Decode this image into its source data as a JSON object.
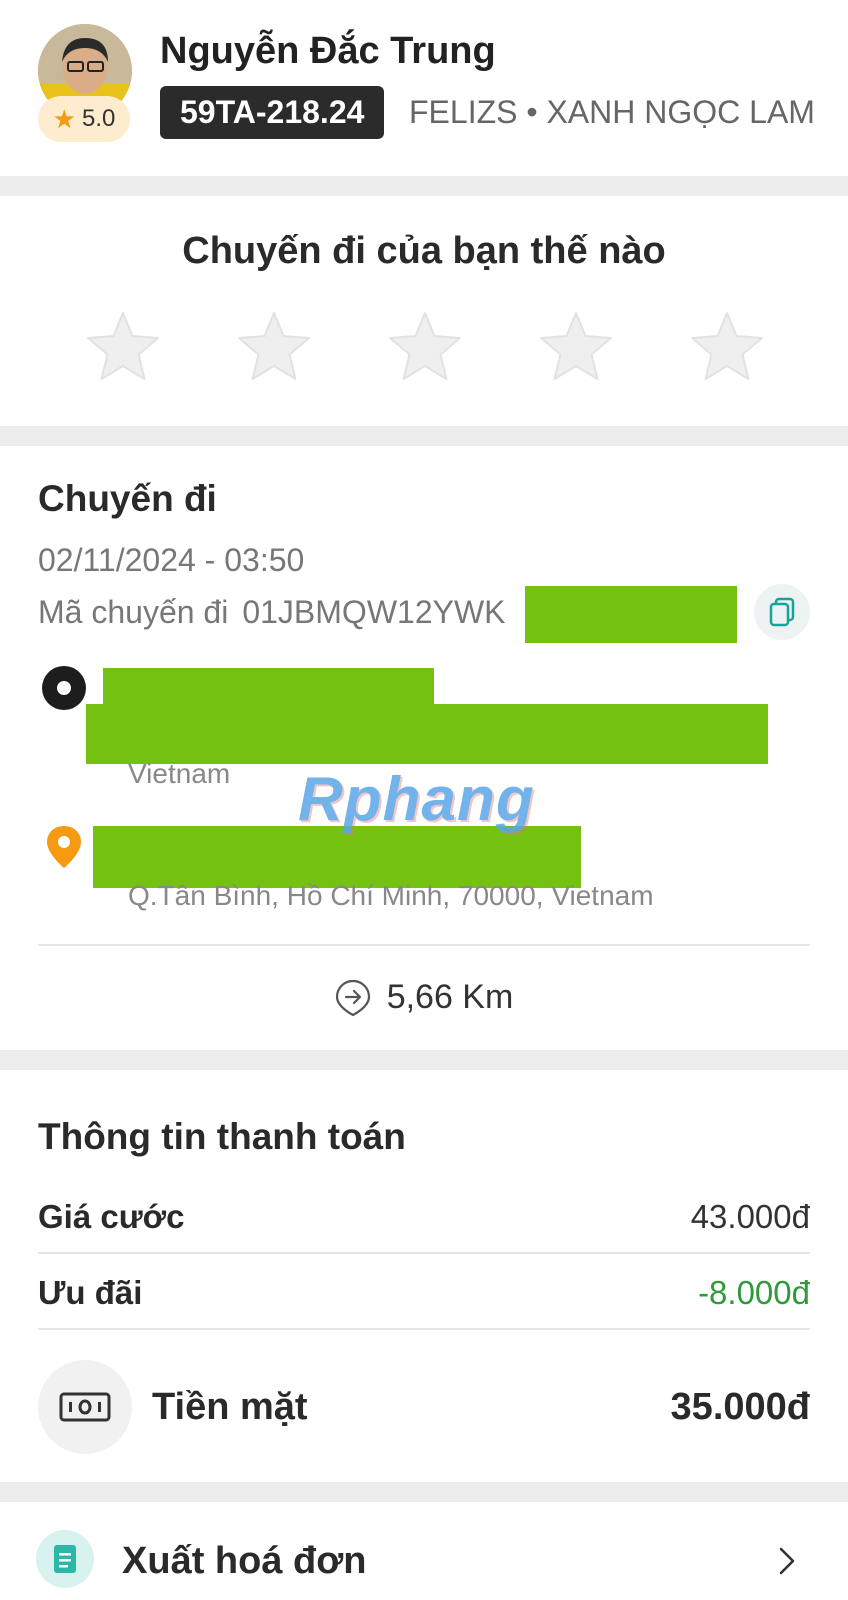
{
  "driver": {
    "name": "Nguyễn Đắc Trung",
    "rating": "5.0",
    "plate": "59TA-218.24",
    "vehicle": "FELIZS • XANH NGỌC LAM"
  },
  "rating_prompt": {
    "title": "Chuyến đi của bạn thế nào",
    "star_count": 5,
    "selected": 0
  },
  "trip": {
    "title": "Chuyến đi",
    "datetime": "02/11/2024 - 03:50",
    "code_label": "Mã chuyến đi",
    "code_value": "01JBMQW12YWK",
    "pickup_sub": "Vietnam",
    "dropoff_sub": "Q.Tân Bình, Hồ Chí Minh, 70000, Vietnam",
    "distance": "5,66 Km",
    "watermark": "Rphang"
  },
  "payment": {
    "title": "Thông tin thanh toán",
    "fare_label": "Giá cước",
    "fare_value": "43.000đ",
    "discount_label": "Ưu đãi",
    "discount_value": "-8.000đ",
    "method_label": "Tiền mặt",
    "total": "35.000đ"
  },
  "invoice": {
    "label": "Xuất hoá đơn"
  },
  "colors": {
    "accent_orange": "#f59a11",
    "discount_green": "#2f9a3a",
    "redaction_green": "#74c111",
    "star_empty": "#efefef"
  }
}
